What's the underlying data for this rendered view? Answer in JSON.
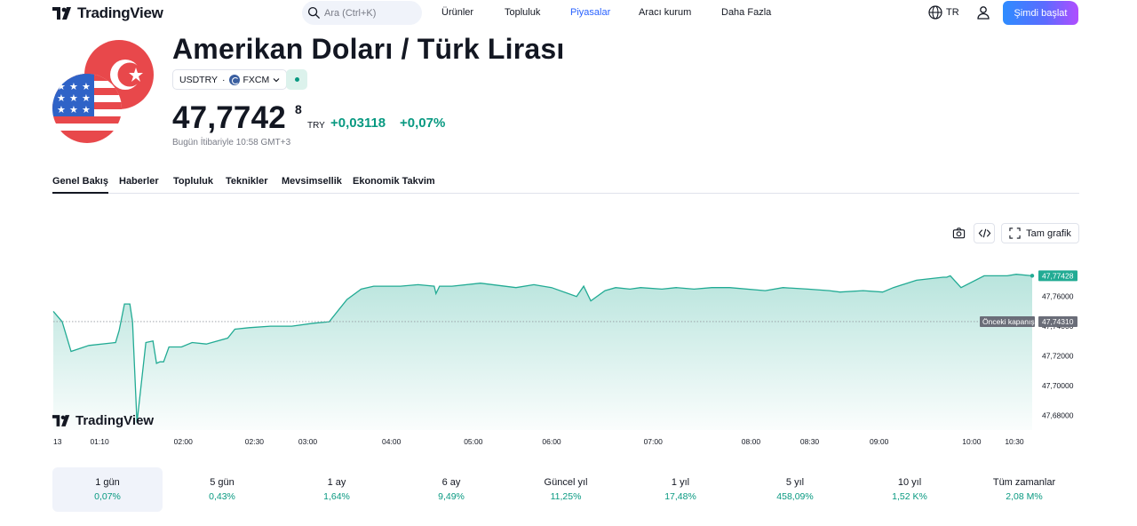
{
  "header": {
    "logo_text": "TradingView",
    "search_placeholder": "Ara (Ctrl+K)",
    "nav": [
      "Ürünler",
      "Topluluk",
      "Piyasalar",
      "Aracı kurum",
      "Daha Fazla"
    ],
    "active_nav": "Piyasalar",
    "language": "TR",
    "start_button": "Şimdi başlat"
  },
  "symbol": {
    "title": "Amerikan Doları / Türk Lirası",
    "ticker": "USDTRY",
    "separator": "·",
    "exchange": "FXCM",
    "price_main": "47,7742",
    "price_sup": "8",
    "currency": "TRY",
    "change": "+0,03118",
    "change_pct": "+0,07%",
    "timestamp": "Bugün İtibariyle 10:58 GMT+3"
  },
  "tabs": [
    "Genel Bakış",
    "Haberler",
    "Topluluk",
    "Teknikler",
    "Mevsimsellik",
    "Ekonomik Takvim"
  ],
  "chart_tools": {
    "fullscreen_label": "Tam grafik"
  },
  "colors": {
    "accent": "#2962ff",
    "positive": "#089981",
    "line": "#22ab94",
    "prev_close_tag": "#6a6d78"
  },
  "chart_data": {
    "type": "area",
    "watermark": "TradingView",
    "x_ticks": [
      "13",
      "01:10",
      "02:00",
      "02:30",
      "03:00",
      "04:00",
      "05:00",
      "06:00",
      "07:00",
      "08:00",
      "08:30",
      "09:00",
      "10:00",
      "10:30"
    ],
    "y_ticks": [
      "47,76000",
      "47,74000",
      "47,72000",
      "47,70000",
      "47,68000"
    ],
    "ylim": [
      47.67,
      47.785
    ],
    "last_value_label": "47,77428",
    "prev_close_label": "Önceki kapanış",
    "prev_close_value": "47,74310",
    "series": [
      {
        "x": [
          0,
          0.5,
          1.0,
          2.0,
          3.5,
          3.7,
          4.0,
          4.3,
          4.45,
          4.7,
          5.2,
          5.6,
          5.8,
          6.0,
          6.2,
          6.5,
          6.8,
          7.2,
          7.8,
          8.6,
          9.8,
          10.2,
          11.0,
          12.2,
          13.4,
          14.6,
          15.5,
          16.5,
          17.3,
          18.0,
          19.5,
          20.5,
          21.4,
          21.5,
          21.7,
          22.4,
          24.0,
          26.0,
          27.0,
          28.0,
          29.4,
          29.8,
          30.2,
          31.0,
          31.6,
          32.4,
          33.0,
          34.2,
          35.0,
          36.0,
          37.0,
          38.0,
          40.0,
          41.0,
          42.4,
          43.6,
          44.2,
          45.5,
          46.6,
          47.2,
          48.5,
          50.0,
          50.2,
          50.4,
          51.0,
          52.3,
          53.6,
          54.1,
          55.0
        ],
        "values": [
          47.75,
          47.743,
          47.723,
          47.727,
          47.729,
          47.737,
          47.755,
          47.755,
          47.743,
          47.675,
          47.729,
          47.73,
          47.715,
          47.716,
          47.716,
          47.726,
          47.726,
          47.726,
          47.729,
          47.728,
          47.732,
          47.738,
          47.739,
          47.74,
          47.74,
          47.742,
          47.743,
          47.758,
          47.765,
          47.767,
          47.767,
          47.768,
          47.767,
          47.762,
          47.767,
          47.767,
          47.769,
          47.766,
          47.768,
          47.766,
          47.76,
          47.767,
          47.757,
          47.764,
          47.766,
          47.765,
          47.766,
          47.765,
          47.766,
          47.765,
          47.766,
          47.766,
          47.764,
          47.766,
          47.765,
          47.764,
          47.763,
          47.764,
          47.763,
          47.766,
          47.771,
          47.773,
          47.773,
          47.774,
          47.766,
          47.774,
          47.774,
          47.775,
          47.774
        ]
      }
    ]
  },
  "periods": [
    {
      "label": "1 gün",
      "value": "0,07%"
    },
    {
      "label": "5 gün",
      "value": "0,43%"
    },
    {
      "label": "1 ay",
      "value": "1,64%"
    },
    {
      "label": "6 ay",
      "value": "9,49%"
    },
    {
      "label": "Güncel yıl",
      "value": "11,25%"
    },
    {
      "label": "1 yıl",
      "value": "17,48%"
    },
    {
      "label": "5 yıl",
      "value": "458,09%"
    },
    {
      "label": "10 yıl",
      "value": "1,52 K%"
    },
    {
      "label": "Tüm zamanlar",
      "value": "2,08 M%"
    }
  ]
}
